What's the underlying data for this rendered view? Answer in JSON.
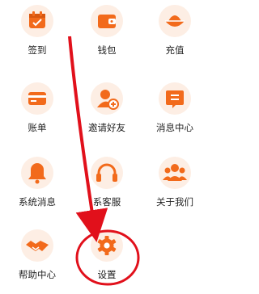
{
  "colors": {
    "accent": "#f26a1b",
    "annotation": "#e1101b",
    "icon_bg": "#fdeee4"
  },
  "menu": [
    {
      "label": "签到",
      "icon": "calendar-check-icon"
    },
    {
      "label": "钱包",
      "icon": "wallet-icon"
    },
    {
      "label": "充值",
      "icon": "gold-ingot-icon"
    },
    {
      "label": "账单",
      "icon": "card-icon"
    },
    {
      "label": "邀请好友",
      "icon": "add-user-icon"
    },
    {
      "label": "消息中心",
      "icon": "message-icon"
    },
    {
      "label": "系统消息",
      "icon": "bell-icon"
    },
    {
      "label": "系客服",
      "icon": "headset-icon"
    },
    {
      "label": "关于我们",
      "icon": "group-icon"
    },
    {
      "label": "帮助中心",
      "icon": "handshake-icon"
    },
    {
      "label": "设置",
      "icon": "gear-icon"
    }
  ]
}
